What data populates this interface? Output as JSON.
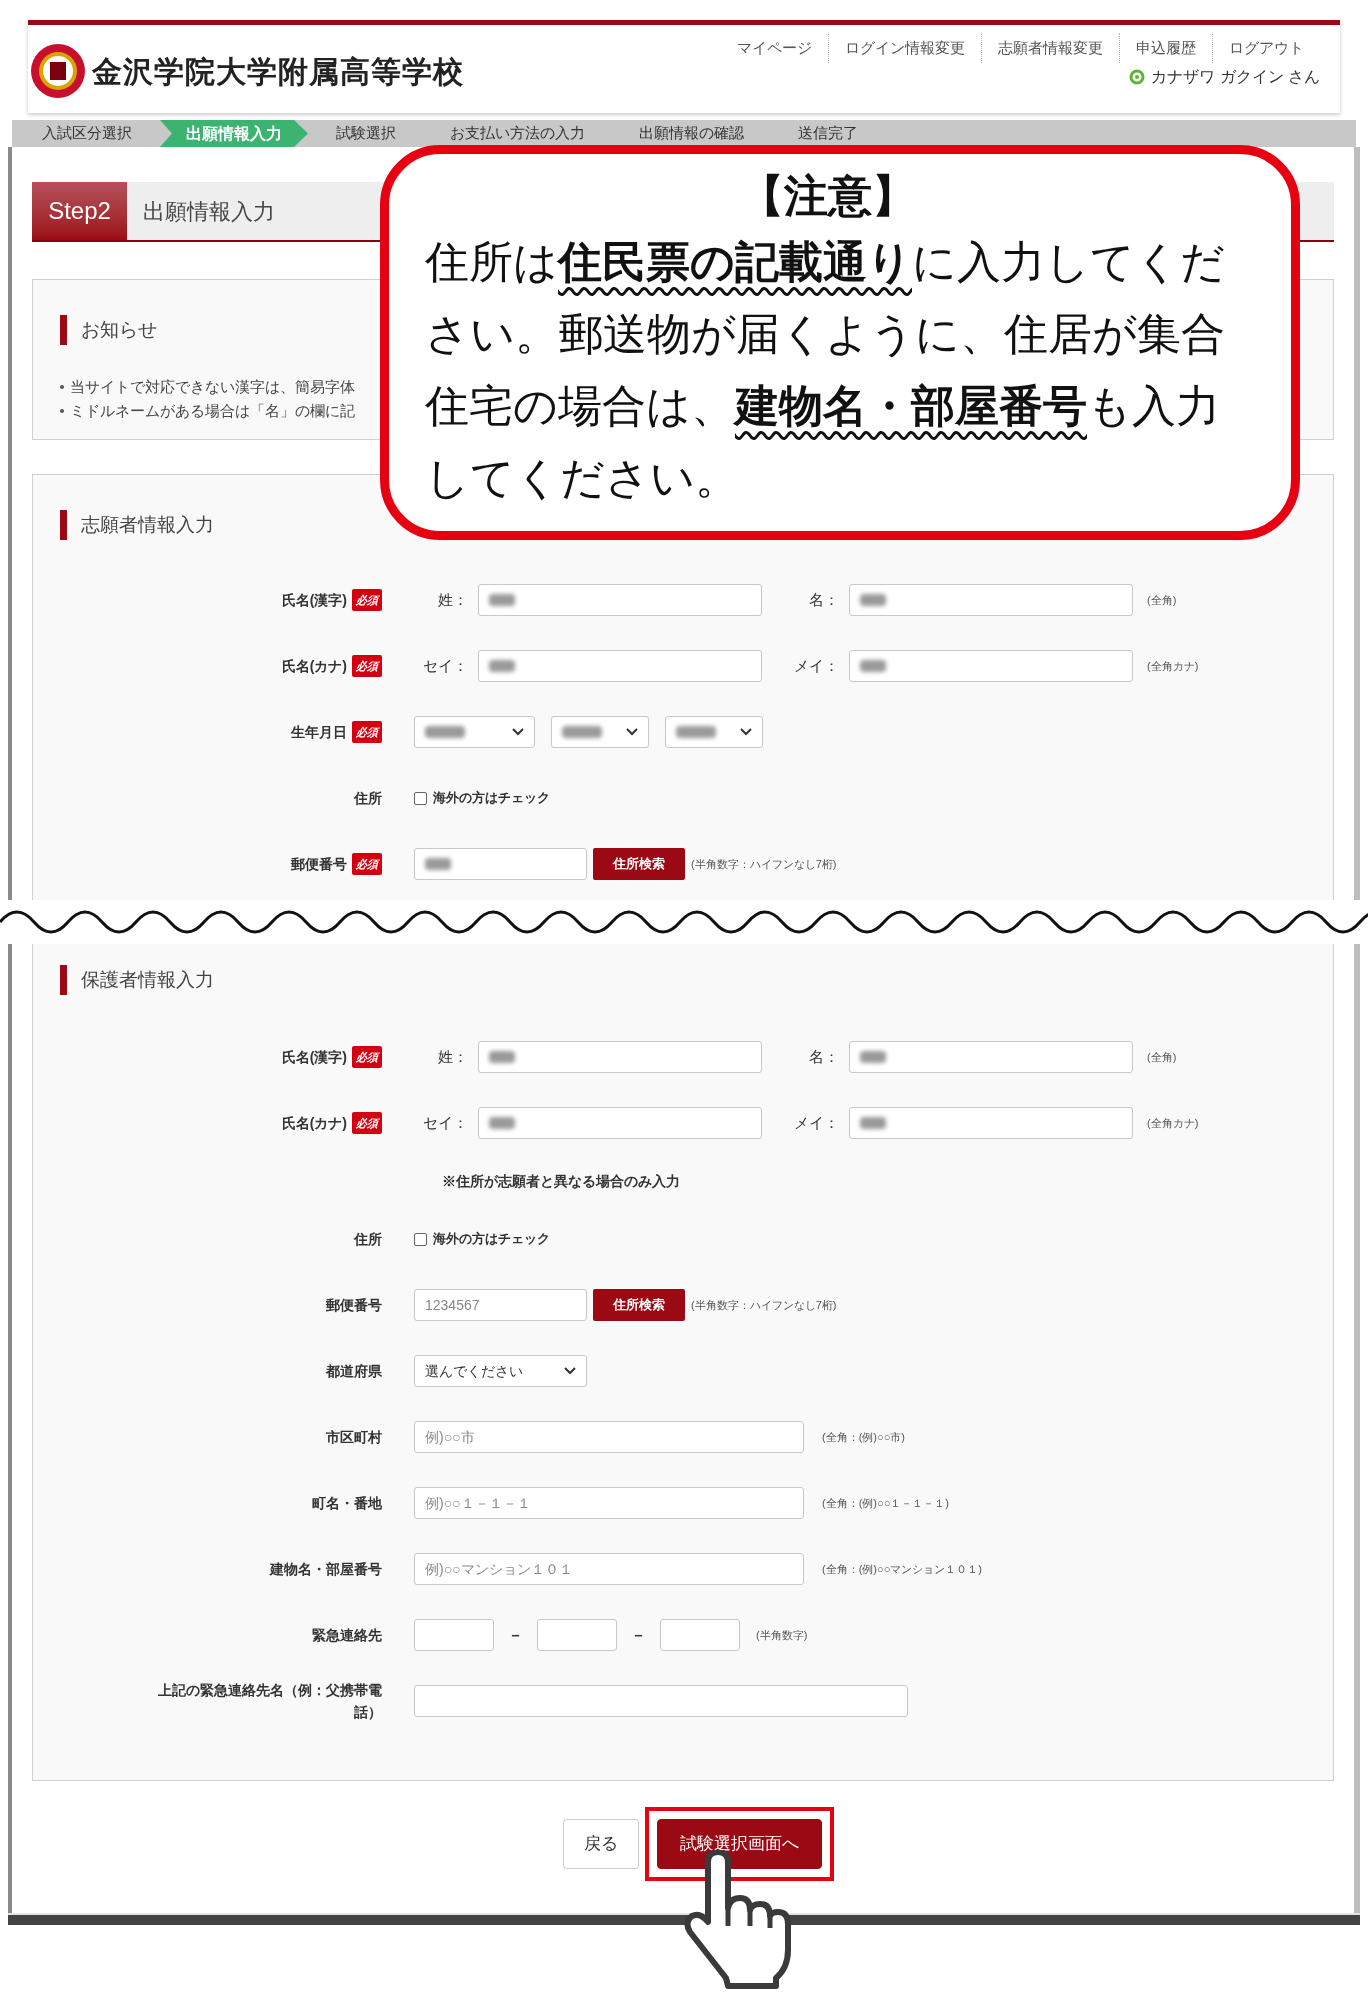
{
  "header": {
    "school_name": "金沢学院大学附属高等学校",
    "nav": [
      "マイページ",
      "ログイン情報変更",
      "志願者情報変更",
      "申込履歴",
      "ログアウト"
    ],
    "user": "カナザワ ガクイン さん"
  },
  "steps": [
    {
      "label": "入試区分選択",
      "selected": false
    },
    {
      "label": "出願情報入力",
      "selected": true
    },
    {
      "label": "試験選択",
      "selected": false
    },
    {
      "label": "お支払い方法の入力",
      "selected": false
    },
    {
      "label": "出願情報の確認",
      "selected": false
    },
    {
      "label": "送信完了",
      "selected": false
    }
  ],
  "step_header": {
    "step": "Step2",
    "title": "出願情報入力"
  },
  "notice": {
    "title": "お知らせ",
    "items": [
      "当サイトで対応できない漢字は、簡易字体",
      "ミドルネームがある場合は「名」の欄に記"
    ]
  },
  "sections": [
    {
      "title": "志願者情報入力",
      "rows": [
        {
          "kind": "name",
          "label": "氏名(漢字)",
          "badge": "必須",
          "first_prefix": "姓：",
          "second_prefix": "名：",
          "blurred": true,
          "note": "(全角)"
        },
        {
          "kind": "name",
          "label": "氏名(カナ)",
          "badge": "必須",
          "first_prefix": "セイ：",
          "second_prefix": "メイ：",
          "blurred": true,
          "note": "(全角カナ)"
        },
        {
          "kind": "date",
          "label": "生年月日",
          "badge": "必須",
          "blurred": true
        },
        {
          "kind": "checkbox",
          "label": "住所",
          "checkbox_label": "海外の方はチェック",
          "checked": false
        },
        {
          "kind": "postal",
          "label": "郵便番号",
          "badge": "必須",
          "blurred": true,
          "button": "住所検索",
          "note": "(半角数字：ハイフンなし7桁)"
        }
      ]
    },
    {
      "title": "保護者情報入力",
      "rows": [
        {
          "kind": "name",
          "label": "氏名(漢字)",
          "badge": "必須",
          "first_prefix": "姓：",
          "second_prefix": "名：",
          "blurred": true,
          "note": "(全角)"
        },
        {
          "kind": "name",
          "label": "氏名(カナ)",
          "badge": "必須",
          "first_prefix": "セイ：",
          "second_prefix": "メイ：",
          "blurred": true,
          "note": "(全角カナ)"
        },
        {
          "kind": "note",
          "text": "※住所が志願者と異なる場合のみ入力"
        },
        {
          "kind": "checkbox",
          "label": "住所",
          "checkbox_label": "海外の方はチェック",
          "checked": false
        },
        {
          "kind": "postal",
          "label": "郵便番号",
          "placeholder": "1234567",
          "blurred": false,
          "button": "住所検索",
          "note": "(半角数字：ハイフンなし7桁)"
        },
        {
          "kind": "select",
          "label": "都道府県",
          "value": "選んでください"
        },
        {
          "kind": "text",
          "label": "市区町村",
          "placeholder": "例)○○市",
          "note": "(全角：(例)○○市)"
        },
        {
          "kind": "text",
          "label": "町名・番地",
          "placeholder": "例)○○１－１－１",
          "note": "(全角：(例)○○１－１－１)"
        },
        {
          "kind": "text",
          "label": "建物名・部屋番号",
          "placeholder": "例)○○マンション１０１",
          "note": "(全角：(例)○○マンション１０１)"
        },
        {
          "kind": "phone",
          "label": "緊急連絡先",
          "separators": [
            "－",
            "－"
          ],
          "note": "(半角数字)"
        },
        {
          "kind": "wide",
          "label": "上記の緊急連絡先名（例：父携帯電話）"
        }
      ]
    }
  ],
  "buttons": [
    {
      "label": "戻る",
      "kind": "secondary",
      "highlighted": false
    },
    {
      "label": "試験選択画面へ",
      "kind": "primary",
      "highlighted": true
    }
  ],
  "callout": {
    "title": "【注意】",
    "text": "住所は**住民票の記載通り**に入力してください。郵送物が届くように、住居が集合住宅の場合は、**建物名・部屋番号**も入力してください。"
  }
}
